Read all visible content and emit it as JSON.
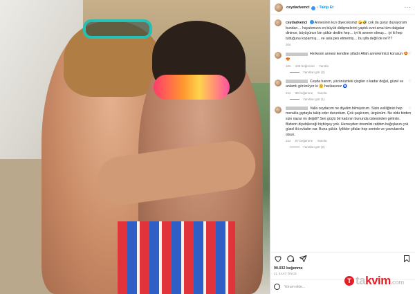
{
  "post": {
    "username": "ceydadvenci",
    "follow_label": "Takip Et",
    "caption": "Annesinin kızı diyeceksiniz 🤪🤣 çok da gurur duyuyorum bundan… hayatımızın en büyük didişmelerini yaptık evet ama tüm dalgalar dinince, büyüyünce bin şükür dedim hep… iyi ki annem olmuş… iyi ki hep tuttuğunu koparmış… ve asla pes etmemiş… bu şifa değil de ne?!?",
    "caption_time": "20s"
  },
  "comments": [
    {
      "text": "Herkesin annesi kendine şifadır Allah annelerimizi korusun 😍😍",
      "time": "10s",
      "likes": "105 beğenme",
      "reply": "Yanıtla",
      "view_replies": "Yanıtları gör (2)"
    },
    {
      "text": "Ceyda hanım, yüzünüzdeki çizgiler o kadar doğal, güzel ve anlamlı görünüyor ki 🤗 harikasınız 🧿",
      "time": "21s",
      "likes": "58 beğenme",
      "reply": "Yanıtla",
      "view_replies": "Yanıtları gör (1)"
    },
    {
      "text": "Valla ceydacım ne diyelim bilmiyorum. Sizin evliliğinizi hep merakla gıptayla takip eder dururdum. Çok şaşkınım, üzgünüm. Ne oldu birden size nazar mı değdi? Sen güçlü bir kadının bununda üstesinden gelirsin. Bizlerin diyebileceği hiçbirşey yok. Herseyden önemlisi rabbim bağışlasın çok güzel iki evladın var. Buna şükür. İyilikler şifalar hep seninle ve yavrularınla olsun.",
      "time": "21s",
      "likes": "57 beğenme",
      "reply": "Yanıtla",
      "view_replies": "Yanıtları gör (2)"
    }
  ],
  "footer": {
    "likes": "90.032 beğenme",
    "time_ago": "21 SAAT ÖNCE",
    "comment_placeholder": "Yorum ekle..."
  },
  "icons": [
    "heart-icon",
    "comment-icon",
    "share-icon",
    "bookmark-icon",
    "emoji-icon",
    "more-icon",
    "verified-icon"
  ],
  "watermark": {
    "brand_prefix": "ta",
    "brand_suffix": "kvim",
    "tld": ".com"
  },
  "colors": {
    "accent": "#0095f6",
    "brand_red": "#e01f26"
  }
}
